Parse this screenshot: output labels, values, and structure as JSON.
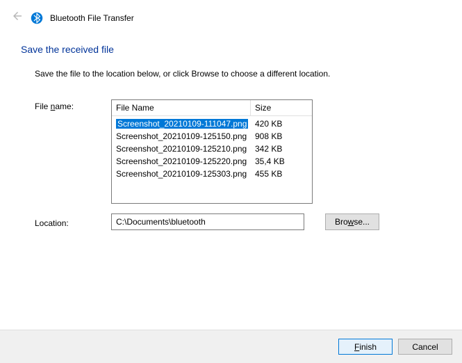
{
  "header": {
    "title": "Bluetooth File Transfer"
  },
  "page": {
    "heading": "Save the received file",
    "instruction": "Save the file to the location below, or click Browse to choose a different location."
  },
  "labels": {
    "file_name_prefix": "File ",
    "file_name_accel": "n",
    "file_name_suffix": "ame:",
    "location": "Location:"
  },
  "filelist": {
    "columns": {
      "name": "File Name",
      "size": "Size"
    },
    "rows": [
      {
        "name": "Screenshot_20210109-111047.png",
        "size": "420 KB",
        "selected": true
      },
      {
        "name": "Screenshot_20210109-125150.png",
        "size": "908 KB",
        "selected": false
      },
      {
        "name": "Screenshot_20210109-125210.png",
        "size": "342 KB",
        "selected": false
      },
      {
        "name": "Screenshot_20210109-125220.png",
        "size": "35,4 KB",
        "selected": false
      },
      {
        "name": "Screenshot_20210109-125303.png",
        "size": "455 KB",
        "selected": false
      }
    ]
  },
  "location": {
    "value": "C:\\Documents\\bluetooth"
  },
  "buttons": {
    "browse_prefix": "Bro",
    "browse_accel": "w",
    "browse_suffix": "se...",
    "finish_accel": "F",
    "finish_suffix": "inish",
    "cancel": "Cancel"
  }
}
